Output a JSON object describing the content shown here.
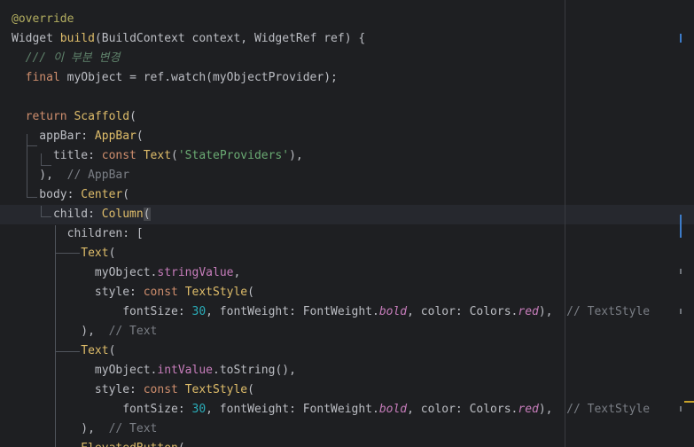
{
  "lines": [
    [
      {
        "t": "@override",
        "c": "ann"
      }
    ],
    [
      {
        "t": "Widget ",
        "c": "def"
      },
      {
        "t": "build",
        "c": "cls"
      },
      {
        "t": "(BuildContext context, WidgetRef ref) {",
        "c": "def"
      }
    ],
    [
      {
        "t": "  /// 이 부분 변경",
        "c": "doc"
      }
    ],
    [
      {
        "t": "  ",
        "c": "def"
      },
      {
        "t": "final ",
        "c": "kw"
      },
      {
        "t": "myObject = ref.watch(myObjectProvider);",
        "c": "def"
      }
    ],
    [],
    [
      {
        "t": "  ",
        "c": "def"
      },
      {
        "t": "return ",
        "c": "kw"
      },
      {
        "t": "Scaffold",
        "c": "cls"
      },
      {
        "t": "(",
        "c": "def"
      }
    ],
    [
      {
        "t": "    appBar: ",
        "c": "def"
      },
      {
        "t": "AppBar",
        "c": "cls"
      },
      {
        "t": "(",
        "c": "def"
      }
    ],
    [
      {
        "t": "      title: ",
        "c": "def"
      },
      {
        "t": "const ",
        "c": "kw"
      },
      {
        "t": "Text",
        "c": "cls"
      },
      {
        "t": "(",
        "c": "def"
      },
      {
        "t": "'StateProviders'",
        "c": "str"
      },
      {
        "t": "),",
        "c": "def"
      }
    ],
    [
      {
        "t": "    ),  ",
        "c": "def"
      },
      {
        "t": "// AppBar",
        "c": "cmt"
      }
    ],
    [
      {
        "t": "    body: ",
        "c": "def"
      },
      {
        "t": "Center",
        "c": "cls"
      },
      {
        "t": "(",
        "c": "def"
      }
    ],
    [
      {
        "t": "      child: ",
        "c": "def"
      },
      {
        "t": "Column",
        "c": "cls"
      },
      {
        "t": "(",
        "c": "sel"
      }
    ],
    [
      {
        "t": "        children: [",
        "c": "def"
      }
    ],
    [
      {
        "t": "          ",
        "c": "def"
      },
      {
        "t": "Text",
        "c": "cls"
      },
      {
        "t": "(",
        "c": "def"
      }
    ],
    [
      {
        "t": "            myObject.",
        "c": "def"
      },
      {
        "t": "stringValue",
        "c": "prop"
      },
      {
        "t": ",",
        "c": "def"
      }
    ],
    [
      {
        "t": "            style: ",
        "c": "def"
      },
      {
        "t": "const ",
        "c": "kw"
      },
      {
        "t": "TextStyle",
        "c": "cls"
      },
      {
        "t": "(",
        "c": "def"
      }
    ],
    [
      {
        "t": "                fontSize: ",
        "c": "def"
      },
      {
        "t": "30",
        "c": "num"
      },
      {
        "t": ", fontWeight: FontWeight.",
        "c": "def"
      },
      {
        "t": "bold",
        "c": "ital"
      },
      {
        "t": ", color: Colors.",
        "c": "def"
      },
      {
        "t": "red",
        "c": "ital"
      },
      {
        "t": "),  ",
        "c": "def"
      },
      {
        "t": "// TextStyle",
        "c": "cmt"
      }
    ],
    [
      {
        "t": "          ),  ",
        "c": "def"
      },
      {
        "t": "// Text",
        "c": "cmt"
      }
    ],
    [
      {
        "t": "          ",
        "c": "def"
      },
      {
        "t": "Text",
        "c": "cls"
      },
      {
        "t": "(",
        "c": "def"
      }
    ],
    [
      {
        "t": "            myObject.",
        "c": "def"
      },
      {
        "t": "intValue",
        "c": "prop"
      },
      {
        "t": ".toString(),",
        "c": "def"
      }
    ],
    [
      {
        "t": "            style: ",
        "c": "def"
      },
      {
        "t": "const ",
        "c": "kw"
      },
      {
        "t": "TextStyle",
        "c": "cls"
      },
      {
        "t": "(",
        "c": "def"
      }
    ],
    [
      {
        "t": "                fontSize: ",
        "c": "def"
      },
      {
        "t": "30",
        "c": "num"
      },
      {
        "t": ", fontWeight: FontWeight.",
        "c": "def"
      },
      {
        "t": "bold",
        "c": "ital"
      },
      {
        "t": ", color: Colors.",
        "c": "def"
      },
      {
        "t": "red",
        "c": "ital"
      },
      {
        "t": "),  ",
        "c": "def"
      },
      {
        "t": "// TextStyle",
        "c": "cmt"
      }
    ],
    [
      {
        "t": "          ),  ",
        "c": "def"
      },
      {
        "t": "// Text",
        "c": "cmt"
      }
    ],
    [
      {
        "t": "          ",
        "c": "def"
      },
      {
        "t": "ElevatedButton",
        "c": "cls"
      },
      {
        "t": "(",
        "c": "def"
      }
    ]
  ],
  "current_line": 10,
  "theme": {
    "background": "#1e1f22",
    "current_line": "#26282e",
    "keyword": "#cf8e6d",
    "class": "#dfbd6a",
    "string": "#6aab73",
    "number": "#2aacb8",
    "property": "#c77dbb",
    "comment": "#7a7e85"
  }
}
